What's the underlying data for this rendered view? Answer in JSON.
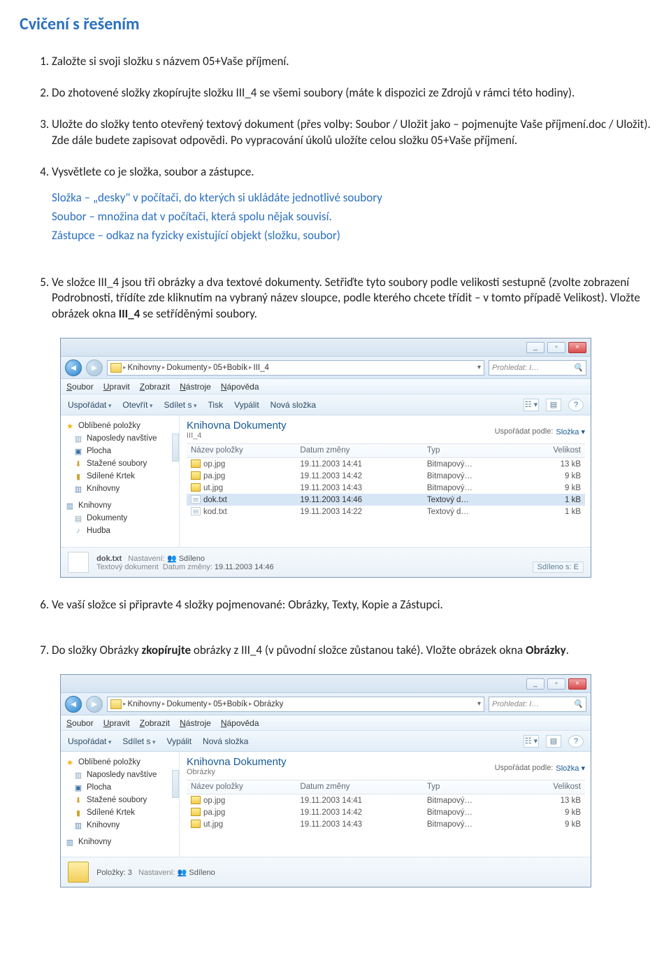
{
  "title": "Cvičení s řešením",
  "tasks": {
    "t1": "Založte si svoji složku s názvem 05+Vaše příjmení.",
    "t2": "Do zhotovené složky zkopírujte složku III_4 se všemi soubory (máte k dispozici ze Zdrojů v rámci této hodiny).",
    "t3": "Uložte do složky tento otevřený textový dokument (přes volby: Soubor / Uložit jako – pojmenujte Vaše příjmení.doc / Uložit). Zde dále budete zapisovat odpovědi. Po vypracování úkolů uložíte celou složku 05+Vaše příjmení.",
    "t4": "Vysvětlete co je složka, soubor a zástupce.",
    "t5_a": "Ve složce III_4 jsou tři obrázky a dva textové dokumenty. Setřiďte tyto soubory podle velikosti sestupně (zvolte zobrazení Podrobnosti, třídíte zde kliknutím na vybraný název sloupce, podle kterého chcete třídit – v tomto případě Velikost). Vložte obrázek okna ",
    "t5_b": "III_4",
    "t5_c": " se setříděnými soubory.",
    "t6": "Ve vaší složce si připravte 4 složky pojmenované: Obrázky, Texty, Kopie a Zástupci.",
    "t7_a": "Do složky Obrázky ",
    "t7_b": "zkopírujte",
    "t7_c": " obrázky z III_4 (v původní složce zůstanou také). Vložte obrázek okna ",
    "t7_d": "Obrázky",
    "t7_e": "."
  },
  "answer4": {
    "a": "Složka – „desky\" v počítači, do kterých si ukládáte jednotlivé soubory",
    "b": "Soubor – množina dat v počítači, která spolu nějak souvisí.",
    "c": "Zástupce – odkaz na fyzicky existující objekt (složku, soubor)"
  },
  "win": {
    "min": "_",
    "max": "▫",
    "close": "×",
    "back": "◄",
    "fwd": "►",
    "sep": "▸",
    "drop": "▾",
    "searchPrefix": "Prohledat: I…",
    "searchIcon": "🔍"
  },
  "shot1": {
    "breadcrumb": [
      "Knihovny",
      "Dokumenty",
      "05+Bobík",
      "III_4"
    ],
    "menus": [
      "Soubor",
      "Upravit",
      "Zobrazit",
      "Nástroje",
      "Nápověda"
    ],
    "toolbar": {
      "org": "Uspořádat",
      "open": "Otevřít",
      "share": "Sdílet s",
      "print": "Tisk",
      "burn": "Vypálit",
      "newf": "Nová složka",
      "view": "☷ ▾",
      "help": "?"
    },
    "nav": {
      "fav": "Oblíbené položky",
      "recent": "Naposledy navštíve",
      "desk": "Plocha",
      "down": "Stažené soubory",
      "shared": "Sdílené Krtek",
      "libs": "Knihovny",
      "libs2": "Knihovny",
      "docs": "Dokumenty",
      "music": "Hudba"
    },
    "libTitle": "Knihovna Dokumenty",
    "libSub": "III_4",
    "sortBy": "Uspořádat podle:",
    "sortVal": "Složka",
    "cols": [
      "Název položky",
      "Datum změny",
      "Typ",
      "Velikost"
    ],
    "rows": [
      {
        "name": "op.jpg",
        "date": "19.11.2003 14:41",
        "type": "Bitmapový…",
        "size": "13 kB",
        "kind": "img"
      },
      {
        "name": "pa.jpg",
        "date": "19.11.2003 14:42",
        "type": "Bitmapový…",
        "size": "9 kB",
        "kind": "img"
      },
      {
        "name": "ut.jpg",
        "date": "19.11.2003 14:43",
        "type": "Bitmapový…",
        "size": "9 kB",
        "kind": "img"
      },
      {
        "name": "dok.txt",
        "date": "19.11.2003 14:46",
        "type": "Textový d…",
        "size": "1 kB",
        "kind": "txt",
        "sel": true
      },
      {
        "name": "kod.txt",
        "date": "19.11.2003 14:22",
        "type": "Textový d…",
        "size": "1 kB",
        "kind": "txt"
      }
    ],
    "details": {
      "name": "dok.txt",
      "sub": "Textový dokument",
      "setLabel": "Nastavení:",
      "setVal": "Sdíleno",
      "dateLabel": "Datum změny:",
      "dateVal": "19.11.2003 14:46",
      "shared": "Sdíleno s: E"
    }
  },
  "shot2": {
    "breadcrumb": [
      "Knihovny",
      "Dokumenty",
      "05+Bobík",
      "Obrázky"
    ],
    "menus": [
      "Soubor",
      "Upravit",
      "Zobrazit",
      "Nástroje",
      "Nápověda"
    ],
    "toolbar": {
      "org": "Uspořádat",
      "share": "Sdílet s",
      "burn": "Vypálit",
      "newf": "Nová složka",
      "view": "☷ ▾",
      "help": "?"
    },
    "nav": {
      "fav": "Oblíbené položky",
      "recent": "Naposledy navštíve",
      "desk": "Plocha",
      "down": "Stažené soubory",
      "shared": "Sdílené Krtek",
      "libs": "Knihovny",
      "libs2": "Knihovny"
    },
    "libTitle": "Knihovna Dokumenty",
    "libSub": "Obrázky",
    "sortBy": "Uspořádat podle:",
    "sortVal": "Složka",
    "cols": [
      "Název položky",
      "Datum změny",
      "Typ",
      "Velikost"
    ],
    "rows": [
      {
        "name": "op.jpg",
        "date": "19.11.2003 14:41",
        "type": "Bitmapový…",
        "size": "13 kB",
        "kind": "img"
      },
      {
        "name": "pa.jpg",
        "date": "19.11.2003 14:42",
        "type": "Bitmapový…",
        "size": "9 kB",
        "kind": "img"
      },
      {
        "name": "ut.jpg",
        "date": "19.11.2003 14:43",
        "type": "Bitmapový…",
        "size": "9 kB",
        "kind": "img"
      }
    ],
    "details": {
      "name": "Položky: 3",
      "setLabel": "Nastavení:",
      "setVal": "Sdíleno"
    }
  }
}
